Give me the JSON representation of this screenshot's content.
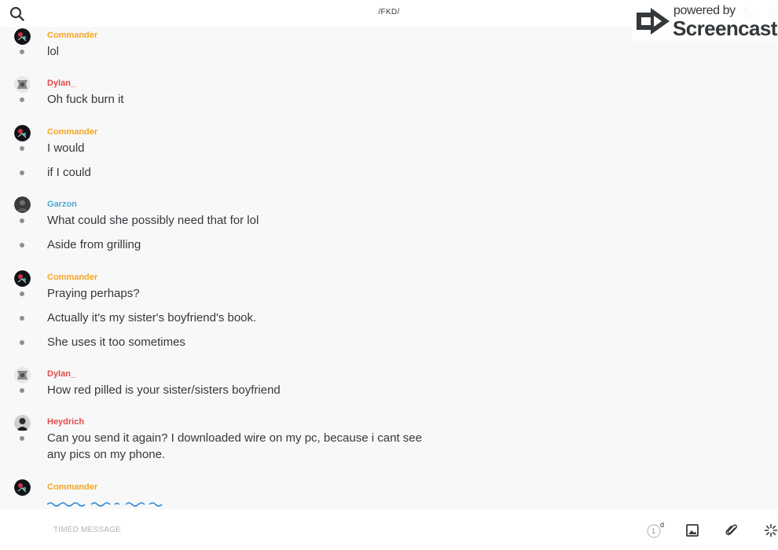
{
  "header": {
    "title": "/FKD/",
    "icons": {
      "search": "search-icon",
      "call": "phone-icon",
      "info": "info-icon"
    }
  },
  "watermark": {
    "line1": "powered by",
    "line2": "Screencastify"
  },
  "colors": {
    "commander": "#f5a623",
    "dylan": "#e24b4b",
    "garzon": "#54a7d4",
    "heydrich": "#e24b4b",
    "background": "#f8f8f9"
  },
  "messages": [
    {
      "sender": "Commander",
      "lines": [
        "lol"
      ]
    },
    {
      "sender": "Dylan_",
      "lines": [
        "Oh fuck burn it"
      ]
    },
    {
      "sender": "Commander",
      "lines": [
        "I would",
        "if I could"
      ]
    },
    {
      "sender": "Garzon",
      "lines": [
        "What could she possibly need that for lol",
        "Aside from grilling"
      ]
    },
    {
      "sender": "Commander",
      "lines": [
        "Praying perhaps?",
        "Actually it's my sister's boyfriend's book.",
        "She uses it too sometimes"
      ]
    },
    {
      "sender": "Dylan_",
      "lines": [
        "How red pilled is your sister/sisters boyfriend"
      ]
    },
    {
      "sender": "Heydrich",
      "lines": [
        "Can you send it again? I downloaded wire on my pc, because i cant see any pics on my phone."
      ]
    },
    {
      "sender": "Commander",
      "lines": []
    }
  ],
  "composer": {
    "placeholder": "TIMED MESSAGE",
    "timer_value": "1",
    "timer_unit": "d"
  }
}
